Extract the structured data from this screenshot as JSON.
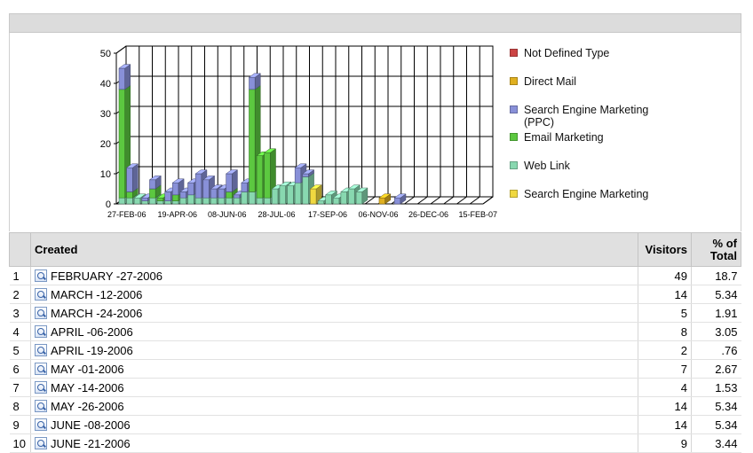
{
  "chart_data": {
    "type": "bar",
    "stacked": true,
    "three_d": true,
    "ylim": [
      0,
      50
    ],
    "yticks": [
      0,
      10,
      20,
      30,
      40,
      50
    ],
    "x_tick_labels": [
      "27-FEB-06",
      "19-APR-06",
      "08-JUN-06",
      "28-JUL-06",
      "17-SEP-06",
      "06-NOV-06",
      "26-DEC-06",
      "15-FEB-07"
    ],
    "grid": true,
    "legend_position": "right",
    "series": [
      {
        "name": "Not Defined Type",
        "color": "#cc4444",
        "values": [
          0,
          0,
          0,
          0,
          0,
          0,
          0,
          0,
          0,
          0,
          0,
          0,
          0,
          0,
          0,
          0,
          0,
          0,
          0,
          0,
          0,
          0,
          0,
          0,
          0,
          0,
          0,
          0,
          0,
          0,
          0,
          0,
          0,
          0,
          0,
          0,
          0,
          0,
          0,
          0,
          0,
          0,
          0,
          0,
          0,
          0,
          0
        ]
      },
      {
        "name": "Direct Mail",
        "color": "#e0b020",
        "values": [
          0,
          0,
          0,
          0,
          0,
          0,
          0,
          0,
          0,
          0,
          0,
          0,
          0,
          0,
          0,
          0,
          0,
          0,
          0,
          0,
          0,
          0,
          0,
          0,
          0,
          0,
          0,
          0,
          0,
          0,
          0,
          0,
          0,
          0,
          2,
          0,
          0,
          0,
          0,
          0,
          0,
          0,
          0,
          0,
          0,
          0,
          0
        ]
      },
      {
        "name": "Search Engine Marketing (PPC)",
        "color": "#8890d8",
        "values": [
          7,
          8,
          0,
          1,
          3,
          0,
          3,
          4,
          2,
          4,
          8,
          6,
          3,
          3,
          6,
          1,
          3,
          4,
          0,
          0,
          0,
          0,
          0,
          5,
          1,
          0,
          0,
          0,
          0,
          0,
          0,
          0,
          0,
          0,
          0,
          0,
          2,
          0,
          0,
          0,
          0,
          0,
          0,
          0,
          0,
          0,
          0
        ]
      },
      {
        "name": "Email Marketing",
        "color": "#5cc840",
        "values": [
          36,
          2,
          0,
          0,
          3,
          1,
          0,
          2,
          0,
          0,
          0,
          0,
          0,
          0,
          2,
          0,
          0,
          34,
          14,
          15,
          0,
          0,
          0,
          0,
          0,
          0,
          0,
          0,
          0,
          0,
          0,
          0,
          0,
          0,
          0,
          0,
          0,
          0,
          0,
          0,
          0,
          0,
          0,
          0,
          0,
          0,
          0
        ]
      },
      {
        "name": "Web Link",
        "color": "#88d8b0",
        "values": [
          2,
          2,
          2,
          1,
          2,
          1,
          1,
          1,
          2,
          3,
          2,
          2,
          2,
          2,
          2,
          2,
          4,
          4,
          2,
          2,
          5,
          6,
          6,
          7,
          9,
          0,
          1,
          3,
          2,
          4,
          5,
          4,
          0,
          0,
          0,
          0,
          0,
          0,
          0,
          0,
          0,
          0,
          0,
          0,
          0,
          0,
          0
        ]
      },
      {
        "name": "Search Engine Marketing",
        "color": "#f0d840",
        "values": [
          0,
          0,
          0,
          0,
          0,
          0,
          0,
          0,
          0,
          0,
          0,
          0,
          0,
          0,
          0,
          0,
          0,
          0,
          0,
          0,
          0,
          0,
          0,
          0,
          0,
          5,
          0,
          0,
          0,
          0,
          0,
          0,
          0,
          0,
          0,
          0,
          0,
          0,
          0,
          0,
          0,
          0,
          0,
          0,
          0,
          0,
          0
        ]
      }
    ]
  },
  "legend": [
    {
      "label": "Not Defined Type",
      "color": "#cc4444"
    },
    {
      "label": "Direct Mail",
      "color": "#e0b020"
    },
    {
      "label": "Search Engine Marketing\n(PPC)",
      "color": "#8890d8"
    },
    {
      "label": "Email Marketing",
      "color": "#5cc840"
    },
    {
      "label": "Web Link",
      "color": "#88d8b0"
    },
    {
      "label": "Search Engine Marketing",
      "color": "#f0d840"
    }
  ],
  "table": {
    "headers": {
      "created": "Created",
      "visitors": "Visitors",
      "pct_line1": "% of",
      "pct_line2": "Total"
    },
    "rows": [
      {
        "index": "1",
        "created": "FEBRUARY -27-2006",
        "visitors": "49",
        "pct": "18.7"
      },
      {
        "index": "2",
        "created": "MARCH -12-2006",
        "visitors": "14",
        "pct": "5.34"
      },
      {
        "index": "3",
        "created": "MARCH -24-2006",
        "visitors": "5",
        "pct": "1.91"
      },
      {
        "index": "4",
        "created": "APRIL -06-2006",
        "visitors": "8",
        "pct": "3.05"
      },
      {
        "index": "5",
        "created": "APRIL -19-2006",
        "visitors": "2",
        "pct": ".76"
      },
      {
        "index": "6",
        "created": "MAY -01-2006",
        "visitors": "7",
        "pct": "2.67"
      },
      {
        "index": "7",
        "created": "MAY -14-2006",
        "visitors": "4",
        "pct": "1.53"
      },
      {
        "index": "8",
        "created": "MAY -26-2006",
        "visitors": "14",
        "pct": "5.34"
      },
      {
        "index": "9",
        "created": "JUNE -08-2006",
        "visitors": "14",
        "pct": "5.34"
      },
      {
        "index": "10",
        "created": "JUNE -21-2006",
        "visitors": "9",
        "pct": "3.44"
      }
    ]
  },
  "icons": {
    "row_icon": "search-report-icon"
  }
}
